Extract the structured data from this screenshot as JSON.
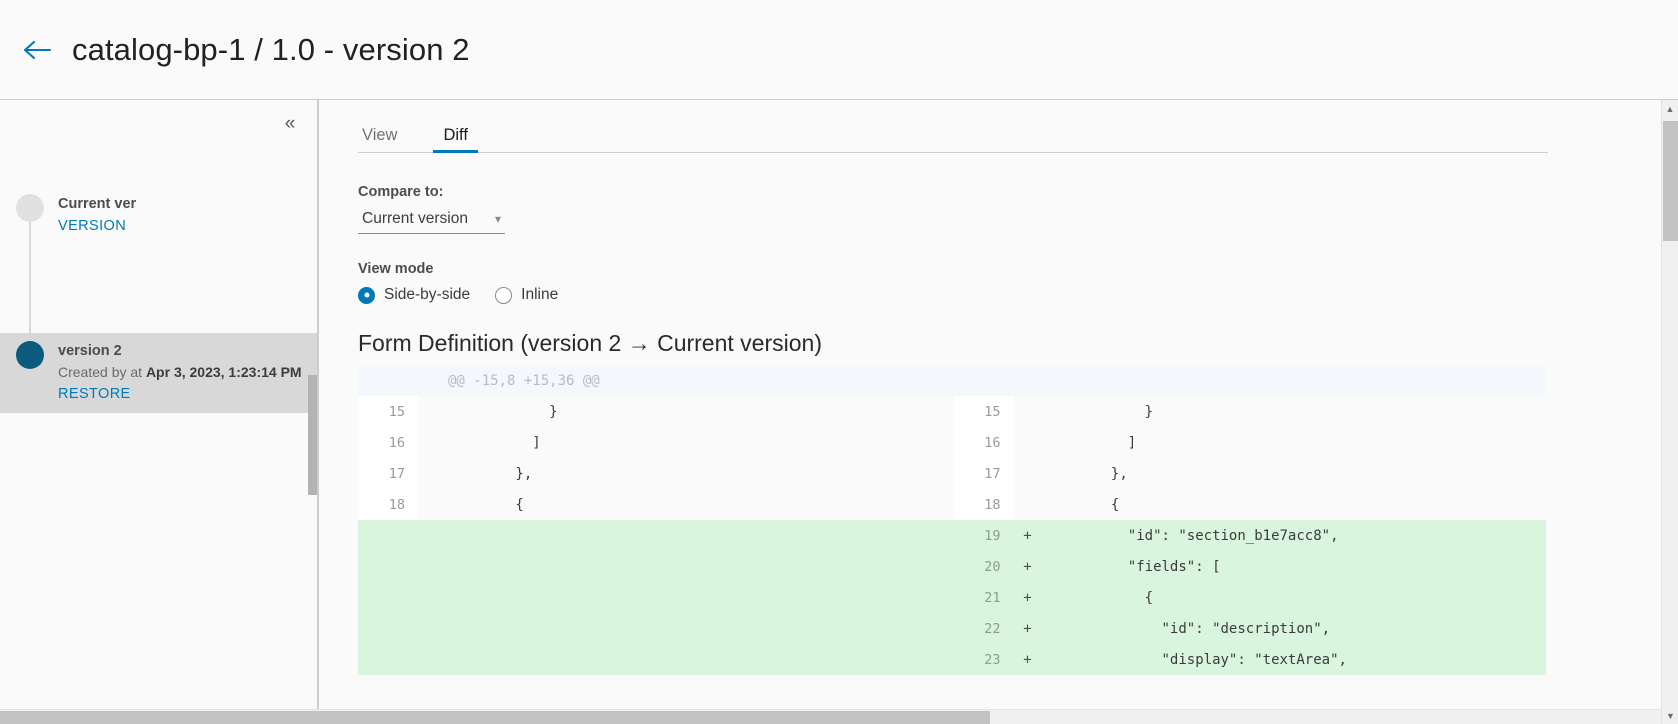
{
  "header": {
    "back_icon": "arrow-left-icon",
    "title": "catalog-bp-1 / 1.0 - version 2",
    "accent_color": "#0079b8"
  },
  "sidebar": {
    "collapse_icon": "chevron-double-left-icon",
    "versions": [
      {
        "name": "Current ver:",
        "action": "VERSION",
        "selected": false,
        "meta": ""
      },
      {
        "name": "version 2",
        "meta_prefix": "Created by  at ",
        "meta_date": "Apr 3, 2023, 1:23:14 PM",
        "action": "RESTORE",
        "selected": true
      }
    ]
  },
  "main": {
    "tabs": [
      {
        "label": "View",
        "active": false
      },
      {
        "label": "Diff",
        "active": true
      }
    ],
    "compare_label": "Compare to:",
    "compare_value": "Current version",
    "compare_caret": "chevron-down-icon",
    "viewmode_label": "View mode",
    "viewmode_options": [
      {
        "label": "Side-by-side",
        "checked": true
      },
      {
        "label": "Inline",
        "checked": false
      }
    ],
    "diff_title": "Form Definition (version 2 → Current version)"
  },
  "diff": {
    "hunk_header": "@@ -15,8 +15,36 @@",
    "rows": [
      {
        "type": "hunk",
        "left_num": "",
        "left_sign": "",
        "left_code": "@@ -15,8 +15,36 @@",
        "right_num": "",
        "right_sign": "",
        "right_code": ""
      },
      {
        "type": "ctx",
        "left_num": "15",
        "left_sign": "",
        "left_code": "            }",
        "right_num": "15",
        "right_sign": "",
        "right_code": "            }"
      },
      {
        "type": "ctx",
        "left_num": "16",
        "left_sign": "",
        "left_code": "          ]",
        "right_num": "16",
        "right_sign": "",
        "right_code": "          ]"
      },
      {
        "type": "ctx",
        "left_num": "17",
        "left_sign": "",
        "left_code": "        },",
        "right_num": "17",
        "right_sign": "",
        "right_code": "        },"
      },
      {
        "type": "ctx",
        "left_num": "18",
        "left_sign": "",
        "left_code": "        {",
        "right_num": "18",
        "right_sign": "",
        "right_code": "        {"
      },
      {
        "type": "add",
        "left_num": "",
        "left_sign": "",
        "left_code": "",
        "right_num": "19",
        "right_sign": "+",
        "right_code": "          \"id\": \"section_b1e7acc8\","
      },
      {
        "type": "add",
        "left_num": "",
        "left_sign": "",
        "left_code": "",
        "right_num": "20",
        "right_sign": "+",
        "right_code": "          \"fields\": ["
      },
      {
        "type": "add",
        "left_num": "",
        "left_sign": "",
        "left_code": "",
        "right_num": "21",
        "right_sign": "+",
        "right_code": "            {"
      },
      {
        "type": "add",
        "left_num": "",
        "left_sign": "",
        "left_code": "",
        "right_num": "22",
        "right_sign": "+",
        "right_code": "              \"id\": \"description\","
      },
      {
        "type": "add",
        "left_num": "",
        "left_sign": "",
        "left_code": "",
        "right_num": "23",
        "right_sign": "+",
        "right_code": "              \"display\": \"textArea\","
      }
    ]
  },
  "scrollbars": {
    "up_arrow": "triangle-up-icon",
    "down_arrow": "triangle-down-icon"
  }
}
